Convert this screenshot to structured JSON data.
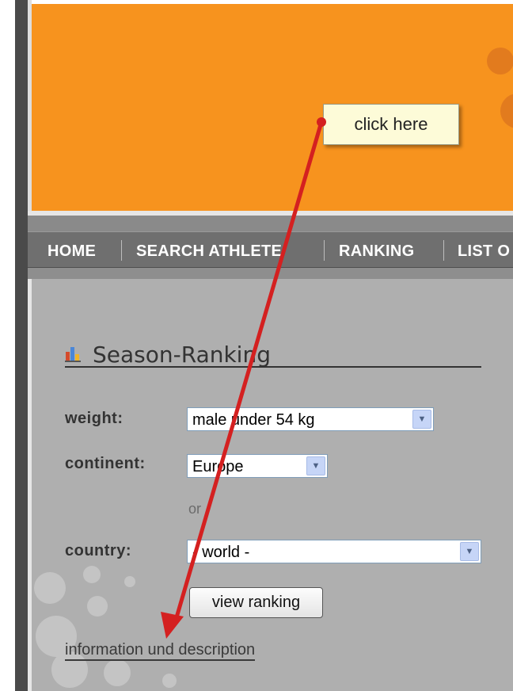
{
  "nav": {
    "items": [
      {
        "label": "HOME"
      },
      {
        "label": "SEARCH ATHLETE"
      },
      {
        "label": "RANKING"
      },
      {
        "label": "LIST O"
      }
    ]
  },
  "ranking": {
    "title": "Season-Ranking",
    "weight_label": "weight:",
    "weight_value": "male under 54 kg",
    "continent_label": "continent:",
    "continent_value": "Europe",
    "or_text": "or",
    "country_label": "country:",
    "country_value": "- world -",
    "view_button": "view ranking",
    "info_link": "information und description"
  },
  "annotation": {
    "callout": "click here",
    "arrow_color": "#d42020"
  },
  "colors": {
    "banner": "#f7931e",
    "nav": "#6f6f6f",
    "panel": "#afafaf"
  },
  "icons": {
    "title_icon": "bar-chart-icon",
    "dropdown": "chevron-down-icon"
  }
}
